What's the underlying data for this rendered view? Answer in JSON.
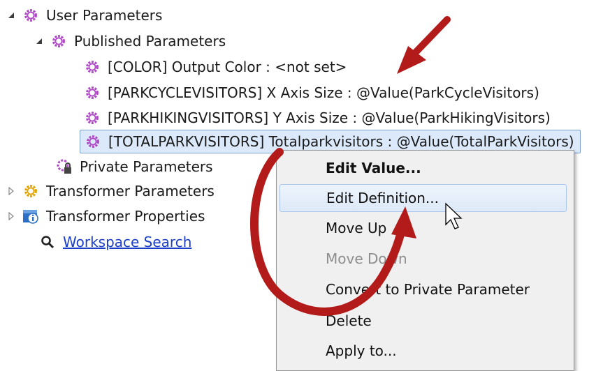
{
  "tree": {
    "user_parameters": "User Parameters",
    "published_parameters": "Published Parameters",
    "published_items": [
      "[COLOR] Output Color : <not set>",
      "[PARKCYCLEVISITORS] X Axis Size : @Value(ParkCycleVisitors)",
      "[PARKHIKINGVISITORS] Y Axis Size : @Value(ParkHikingVisitors)",
      "[TOTALPARKVISITORS] Totalparkvisitors : @Value(TotalParkVisitors)"
    ],
    "private_parameters": "Private Parameters",
    "transformer_parameters": "Transformer Parameters",
    "transformer_properties": "Transformer Properties",
    "workspace_search": "Workspace Search"
  },
  "context_menu": {
    "items": [
      "Edit Value...",
      "Edit Definition...",
      "Move Up",
      "Move Down",
      "Convert to Private Parameter",
      "Delete",
      "Apply to..."
    ],
    "hovered": "Edit Definition...",
    "disabled": [
      "Move Down"
    ]
  },
  "colors": {
    "gear": "#b049c8",
    "gear_yellow": "#e2a400",
    "selection": "#dbe9fb",
    "link": "#1a3ec8",
    "annotation_arrow": "#b31b1b"
  },
  "icons": [
    "expanded-triangle-icon",
    "collapsed-triangle-icon",
    "gear-icon",
    "gear-lock-icon",
    "info-icon",
    "magnifier-icon",
    "mouse-cursor-icon"
  ]
}
